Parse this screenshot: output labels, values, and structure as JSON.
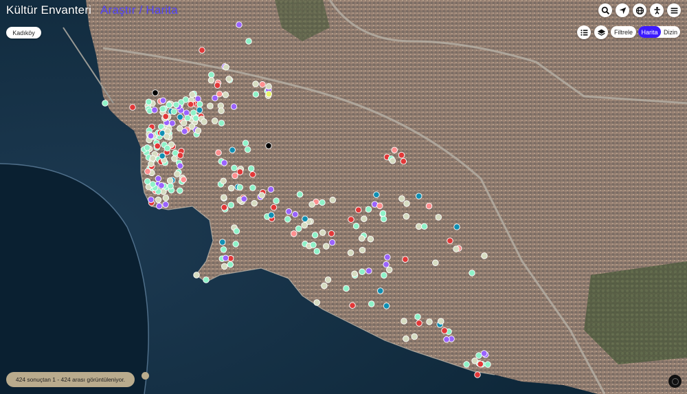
{
  "header": {
    "app_title": "Kültür Envanteri",
    "mode_research": "Araştır",
    "mode_separator": "/",
    "mode_map": "Harita"
  },
  "district": {
    "label": "Kadıköy"
  },
  "toolbar": {
    "search_icon": "search-icon",
    "locate_icon": "location-arrow-icon",
    "language_icon": "globe-icon",
    "accessibility_icon": "accessibility-icon",
    "menu_icon": "hamburger-menu-icon"
  },
  "controls": {
    "list_icon": "list-icon",
    "layers_icon": "layers-icon",
    "filter_label": "Filtrele",
    "view_map_label": "Harita",
    "view_index_label": "Dizin"
  },
  "status": {
    "text": "424 sonuçtan 1 - 424 arası görüntüleniyor."
  },
  "colors": {
    "accent": "#3c1bff",
    "marker_mint": "#8ef2c8",
    "marker_beige": "#d6dcc1",
    "marker_purple": "#9a63ff",
    "marker_red": "#e23838",
    "marker_pink": "#ff8f8f",
    "marker_teal": "#0f8fb3",
    "marker_yellow": "#e7f56b",
    "marker_black": "#000000"
  }
}
